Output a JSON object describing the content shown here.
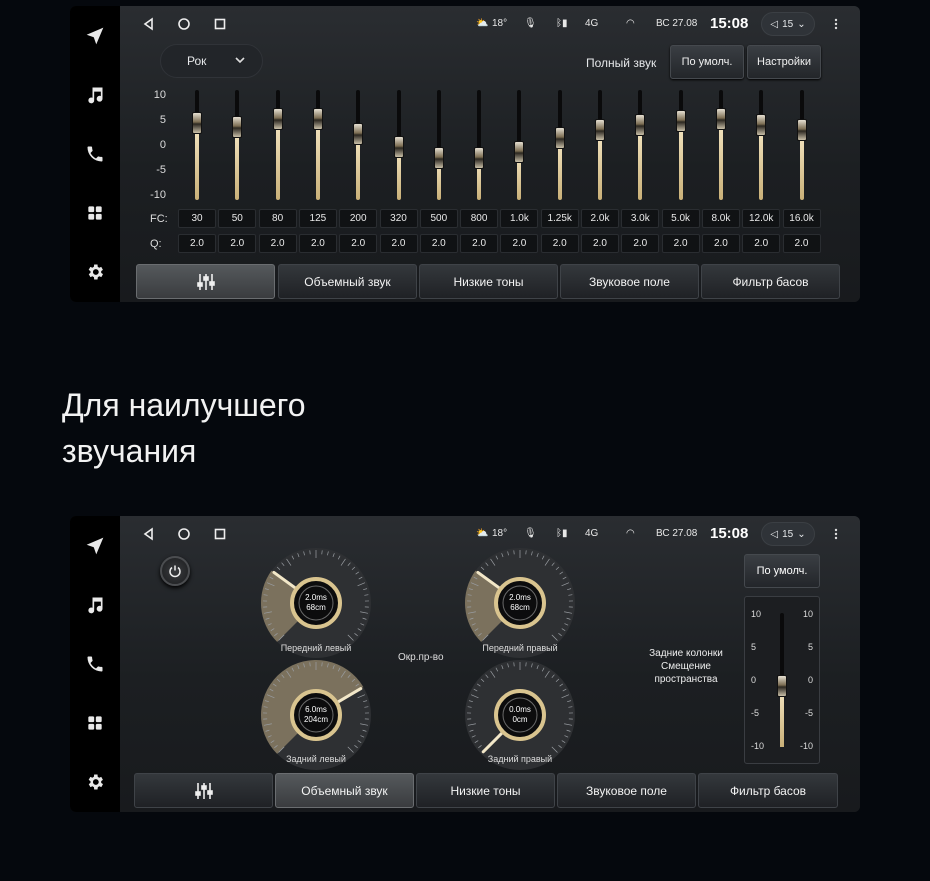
{
  "status": {
    "temperature": "18°",
    "network": "4G",
    "date": "ВС 27.08",
    "time": "15:08",
    "volume": "15"
  },
  "eq": {
    "preset": "Рок",
    "full_sound_label": "Полный звук",
    "default_button": "По умолч.",
    "settings_button": "Настройки",
    "y_labels": [
      "10",
      "5",
      "0",
      "-5",
      "-10"
    ],
    "fc_label": "FC:",
    "q_label": "Q:",
    "bands": [
      {
        "fc": "30",
        "q": "2.0",
        "gain": 5
      },
      {
        "fc": "50",
        "q": "2.0",
        "gain": 4
      },
      {
        "fc": "80",
        "q": "2.0",
        "gain": 6
      },
      {
        "fc": "125",
        "q": "2.0",
        "gain": 6
      },
      {
        "fc": "200",
        "q": "2.0",
        "gain": 2.5
      },
      {
        "fc": "320",
        "q": "2.0",
        "gain": -0.5
      },
      {
        "fc": "500",
        "q": "2.0",
        "gain": -3
      },
      {
        "fc": "800",
        "q": "2.0",
        "gain": -3
      },
      {
        "fc": "1.0k",
        "q": "2.0",
        "gain": -1.5
      },
      {
        "fc": "1.25k",
        "q": "2.0",
        "gain": 1.5
      },
      {
        "fc": "2.0k",
        "q": "2.0",
        "gain": 3.5
      },
      {
        "fc": "3.0k",
        "q": "2.0",
        "gain": 4.5
      },
      {
        "fc": "5.0k",
        "q": "2.0",
        "gain": 5.5
      },
      {
        "fc": "8.0k",
        "q": "2.0",
        "gain": 6
      },
      {
        "fc": "12.0k",
        "q": "2.0",
        "gain": 4.5
      },
      {
        "fc": "16.0k",
        "q": "2.0",
        "gain": 3.5
      }
    ]
  },
  "tabs": {
    "surround": "Объемный звук",
    "bass": "Низкие тоны",
    "soundfield": "Звуковое поле",
    "bassfilter": "Фильтр басов"
  },
  "headline": {
    "line1": "Для наилучшего",
    "line2": "звучания"
  },
  "surround": {
    "center_label": "Окр.пр-во",
    "default_button": "По умолч.",
    "rear_info": [
      "Задние колонки",
      "Смещение",
      "пространства"
    ],
    "slider_left_labels": [
      "10",
      "5",
      "0",
      "-5",
      "-10"
    ],
    "slider_right_labels": [
      "10",
      "5",
      "0",
      "-5",
      "-10"
    ],
    "slider_value": -1,
    "dials": [
      {
        "id": "front-left",
        "label": "Передний левый",
        "time": "2.0ms",
        "dist": "68cm",
        "level": 0.3
      },
      {
        "id": "front-right",
        "label": "Передний правый",
        "time": "2.0ms",
        "dist": "68cm",
        "level": 0.3
      },
      {
        "id": "rear-left",
        "label": "Задний левый",
        "time": "6.0ms",
        "dist": "204cm",
        "level": 0.72
      },
      {
        "id": "rear-right",
        "label": "Задний правый",
        "time": "0.0ms",
        "dist": "0cm",
        "level": 0.0
      }
    ]
  },
  "colors": {
    "accent_gold": "#d9c48f",
    "background": "#05080d"
  }
}
